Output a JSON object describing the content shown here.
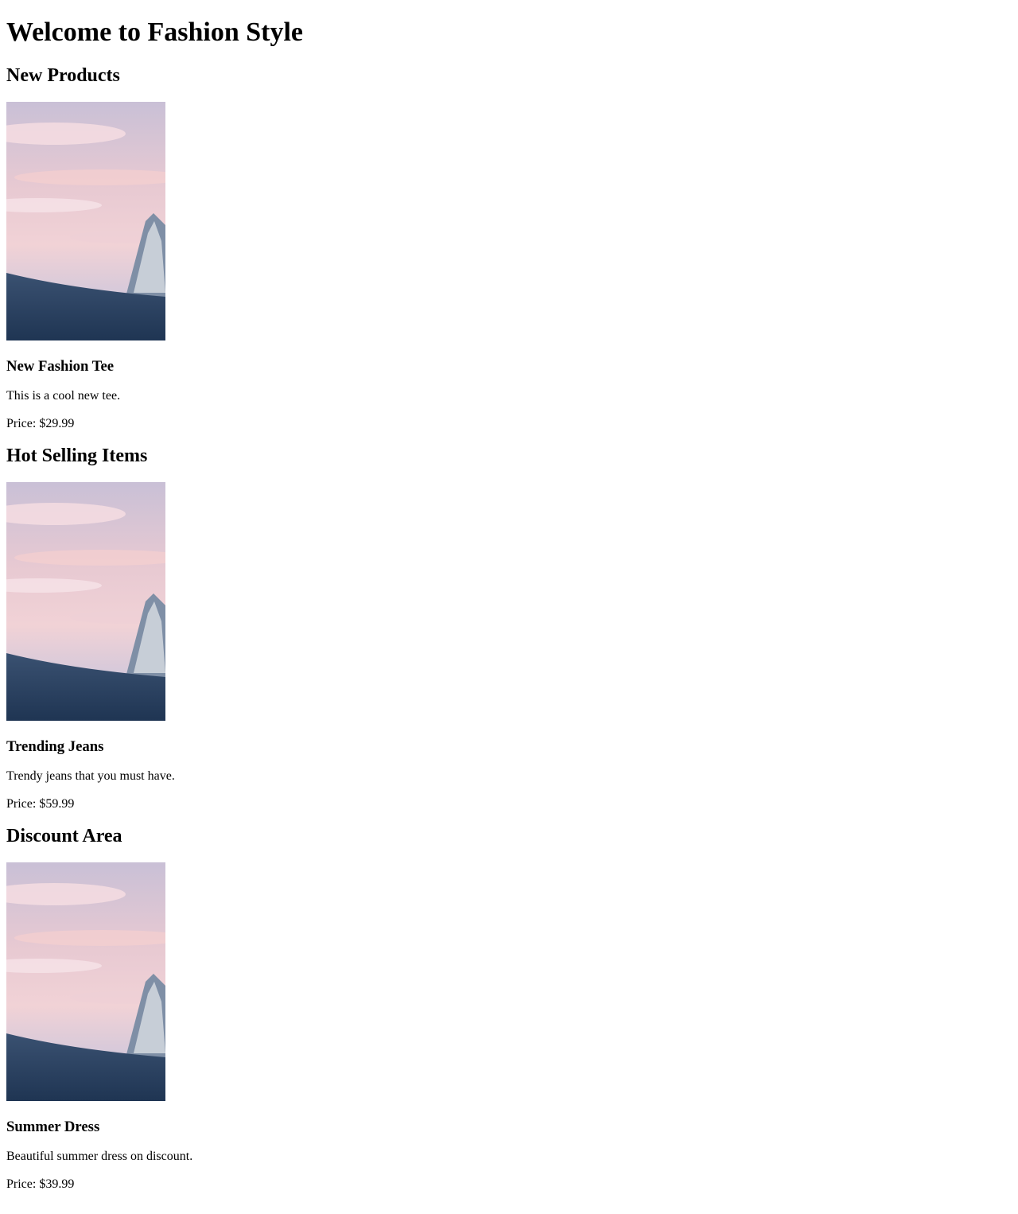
{
  "page": {
    "title": "Welcome to Fashion Style"
  },
  "sections": [
    {
      "title": "New Products",
      "product": {
        "name": "New Fashion Tee",
        "description": "This is a cool new tee.",
        "price": "Price: $29.99",
        "image": "mountain-sunset-photo"
      }
    },
    {
      "title": "Hot Selling Items",
      "product": {
        "name": "Trending Jeans",
        "description": "Trendy jeans that you must have.",
        "price": "Price: $59.99",
        "image": "mountain-sunset-photo"
      }
    },
    {
      "title": "Discount Area",
      "product": {
        "name": "Summer Dress",
        "description": "Beautiful summer dress on discount.",
        "price": "Price: $39.99",
        "image": "mountain-sunset-photo"
      }
    }
  ],
  "colors": {
    "text": "#000000",
    "background": "#ffffff",
    "sky_pink": "#f2c8cc",
    "sky_blue": "#b9b8d2",
    "snow": "#2c4563"
  }
}
